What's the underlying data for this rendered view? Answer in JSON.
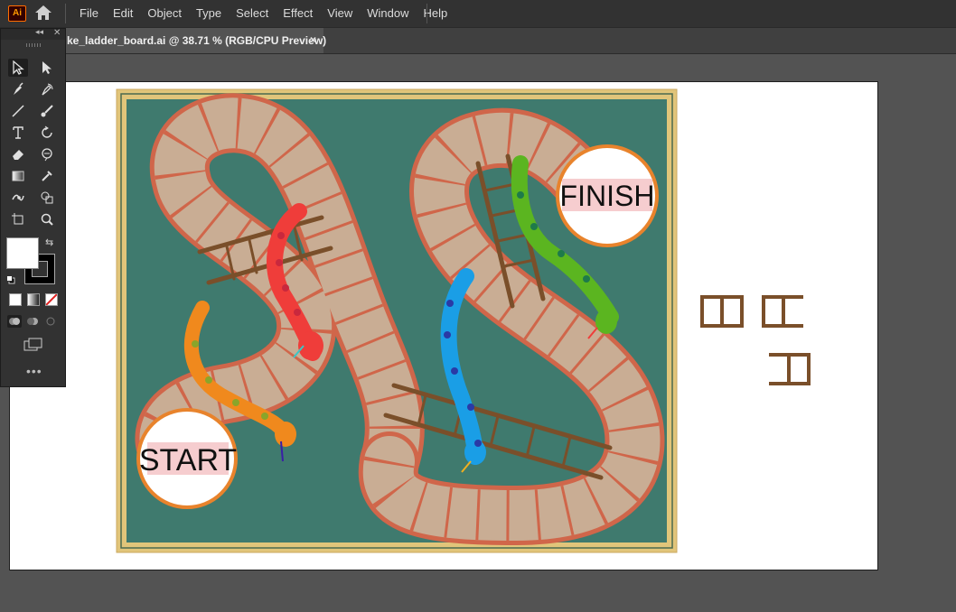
{
  "app": {
    "logo_text": "Ai"
  },
  "menu": [
    "File",
    "Edit",
    "Object",
    "Type",
    "Select",
    "Effect",
    "View",
    "Window",
    "Help"
  ],
  "document_tab": {
    "title": "ke_ladder_board.ai @ 38.71 % (RGB/CPU Preview)",
    "close": "×"
  },
  "toolbar": {
    "tools": [
      "selection-tool",
      "direct-selection-tool",
      "pen-tool",
      "curvature-tool",
      "line-segment-tool",
      "paintbrush-tool",
      "type-tool",
      "rotate-tool",
      "eraser-tool",
      "warp-tool",
      "gradient-tool",
      "eyedropper-tool",
      "puppet-warp-tool",
      "shape-builder-tool",
      "artboard-tool",
      "zoom-tool"
    ],
    "active_tool": "selection-tool",
    "fill_color": "#ffffff",
    "stroke_color": "#000000",
    "more": "•••"
  },
  "board": {
    "start_label": "START",
    "finish_label": "FINISH",
    "colors": {
      "background": "#3f7a6e",
      "frame": "#e1c57a",
      "path_fill": "#c9ad94",
      "path_stroke": "#d0664a",
      "ladder": "#7a4f2a",
      "circle_ring": "#e8832c",
      "label_highlight": "#f6cdcf"
    }
  }
}
